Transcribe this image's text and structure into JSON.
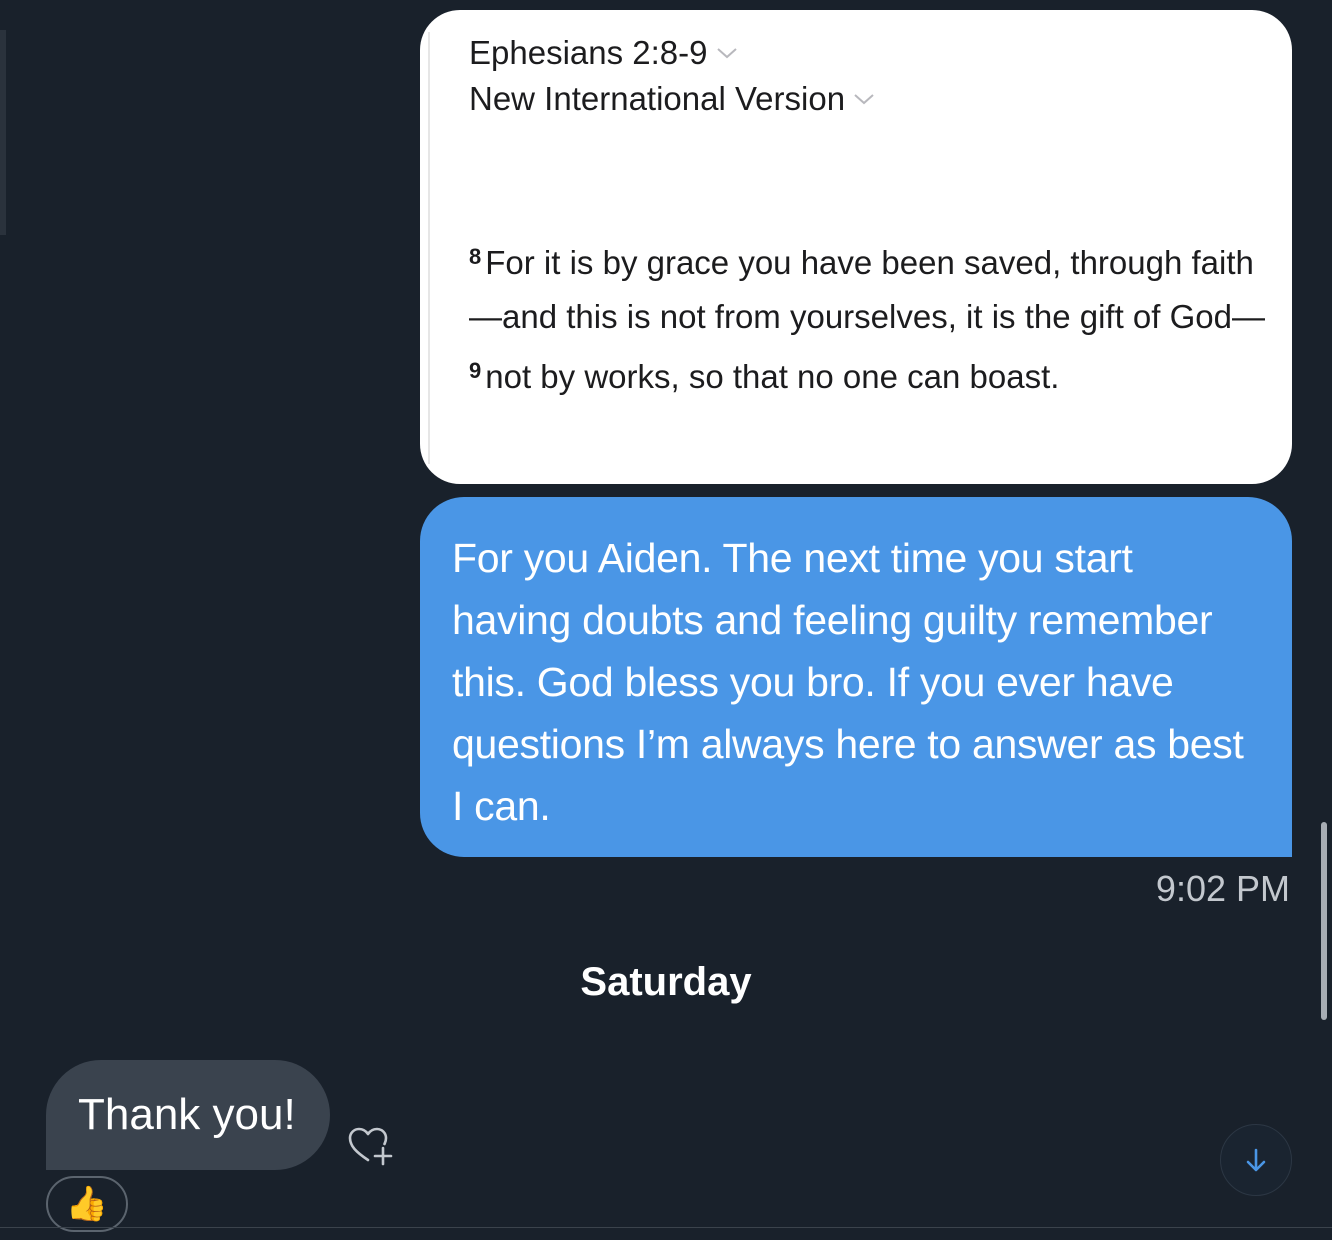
{
  "image_attachment": {
    "reference": "Ephesians 2:8-9",
    "translation": "New International Version",
    "verse_8_num": "8",
    "verse_8_text": "For it is by grace you have been saved, through faith—and this is not from yourselves, it is the gift of God—",
    "verse_9_num": "9",
    "verse_9_text": "not by works, so that no one can boast."
  },
  "sent_message": {
    "text": "For you Aiden. The next time you start having doubts and feeling guilty remember this. God bless you bro. If you ever have questions I’m always here to answer as best I can.",
    "timestamp": "9:02 PM"
  },
  "day_separator": "Saturday",
  "received_message": {
    "text": "Thank you!",
    "reaction": "👍"
  },
  "icons": {
    "add_reaction": "heart-plus-icon",
    "scroll_down": "arrow-down-icon",
    "chevron": "chevron-down-icon"
  },
  "colors": {
    "background": "#19212b",
    "sent_bubble": "#4a96e6",
    "received_bubble": "#3a434e"
  }
}
